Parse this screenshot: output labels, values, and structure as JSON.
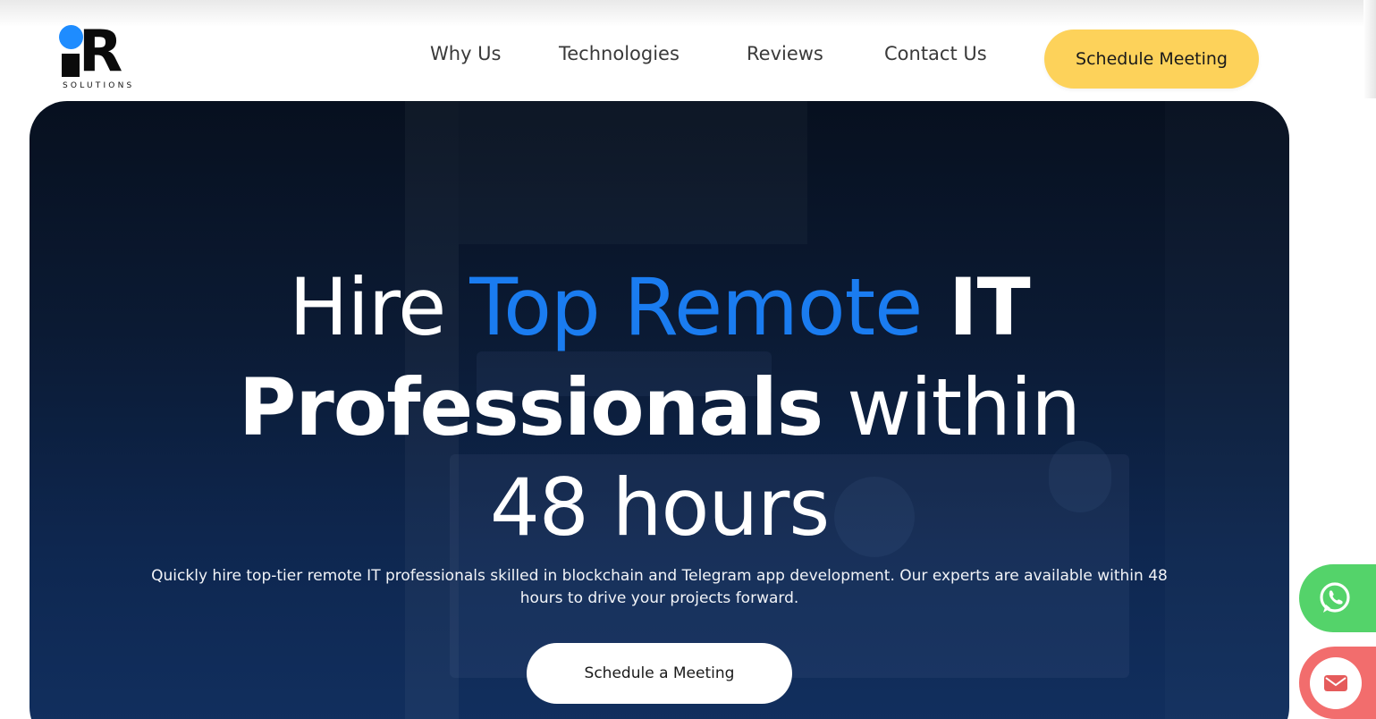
{
  "brand": {
    "logo_sub": "SOLUTIONS",
    "logo_letters": "R",
    "colors": {
      "dot": "#1e8cff",
      "accent_yellow": "#fdd25a",
      "accent_blue": "#1a7cf0"
    }
  },
  "nav": {
    "items": [
      {
        "label": "Why Us"
      },
      {
        "label": "Technologies"
      },
      {
        "label": "Reviews"
      },
      {
        "label": "Contact Us"
      }
    ],
    "cta_label": "Schedule Meeting"
  },
  "hero": {
    "title_part1": "Hire ",
    "title_highlight": "Top Remote",
    "title_part2": " IT",
    "title_line2_bold": "Professionals",
    "title_line2_rest": " within",
    "title_line3": "48 hours",
    "description": "Quickly hire top-tier remote IT professionals skilled in blockchain and Telegram app development. Our experts are available within 48 hours to drive your projects forward.",
    "cta_label": "Schedule a Meeting"
  },
  "floating": {
    "whatsapp_icon": "whatsapp-icon",
    "mail_icon": "mail-icon",
    "colors": {
      "whatsapp": "#54d36a",
      "mail": "#f26d6d"
    }
  }
}
